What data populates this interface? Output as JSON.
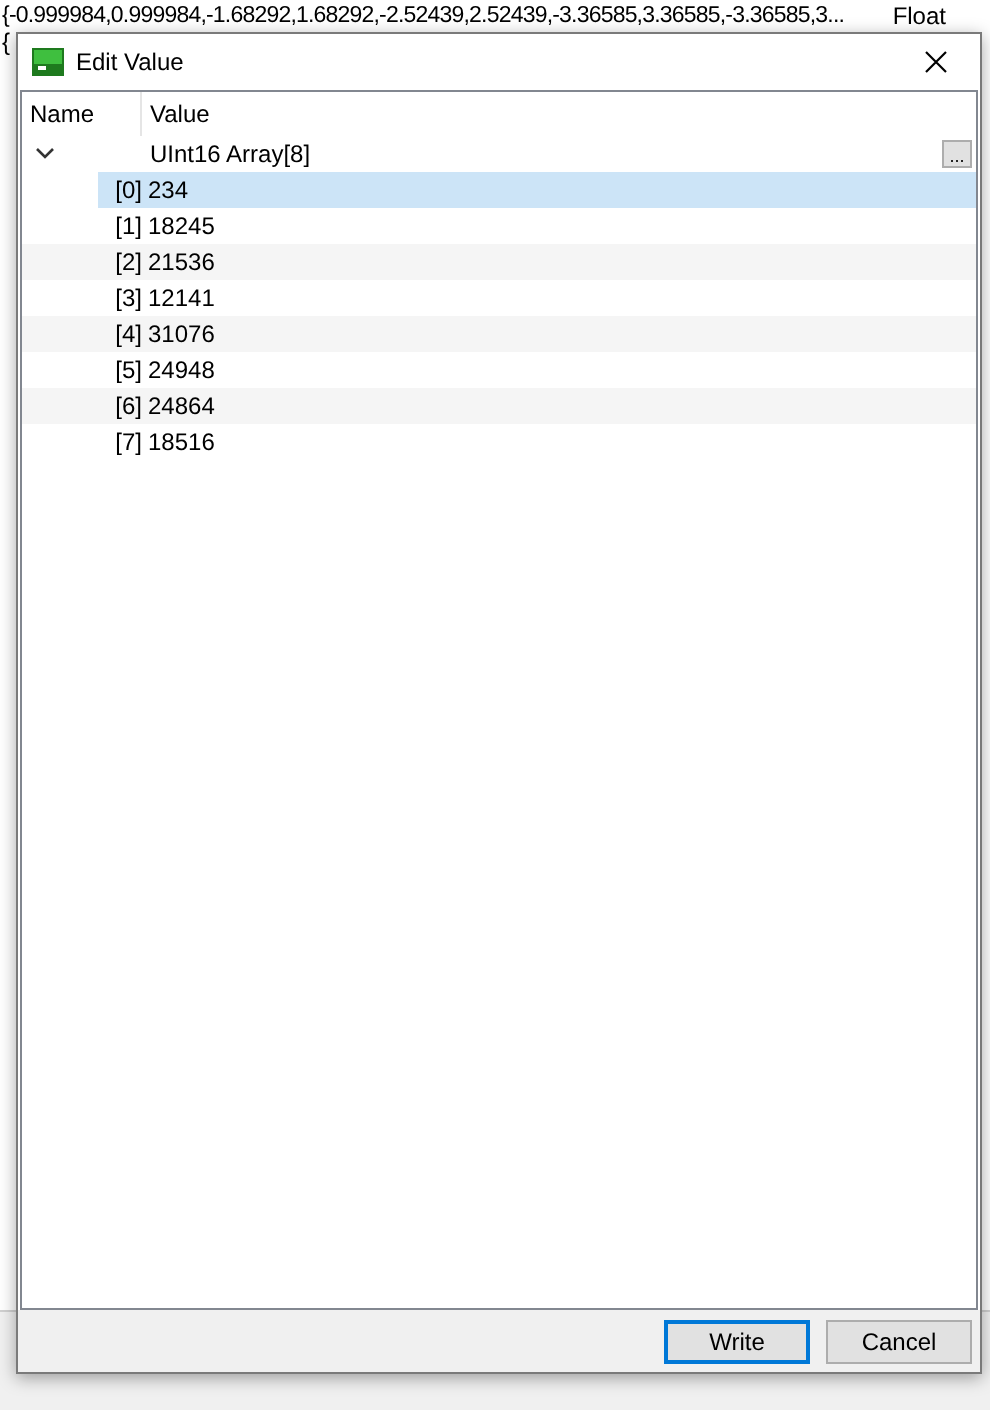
{
  "background": {
    "lines": [
      "{-0.999984,0.999984,-1.68292,1.68292,-2.52439,2.52439,-3.36585,3.36585,-3.36585,3...",
      "{"
    ],
    "type_label": "Float"
  },
  "dialog": {
    "title": "Edit Value",
    "columns": [
      "Name",
      "Value"
    ],
    "root": {
      "value": "UInt16 Array[8]",
      "expanded": true,
      "button": "...",
      "children": [
        {
          "name": "[0]",
          "value": "234",
          "selected": true
        },
        {
          "name": "[1]",
          "value": "18245",
          "selected": false
        },
        {
          "name": "[2]",
          "value": "21536",
          "selected": false
        },
        {
          "name": "[3]",
          "value": "12141",
          "selected": false
        },
        {
          "name": "[4]",
          "value": "31076",
          "selected": false
        },
        {
          "name": "[5]",
          "value": "24948",
          "selected": false
        },
        {
          "name": "[6]",
          "value": "24864",
          "selected": false
        },
        {
          "name": "[7]",
          "value": "18516",
          "selected": false
        }
      ]
    },
    "buttons": [
      {
        "label": "Write",
        "kind": "default"
      },
      {
        "label": "Cancel",
        "kind": "normal"
      }
    ]
  }
}
